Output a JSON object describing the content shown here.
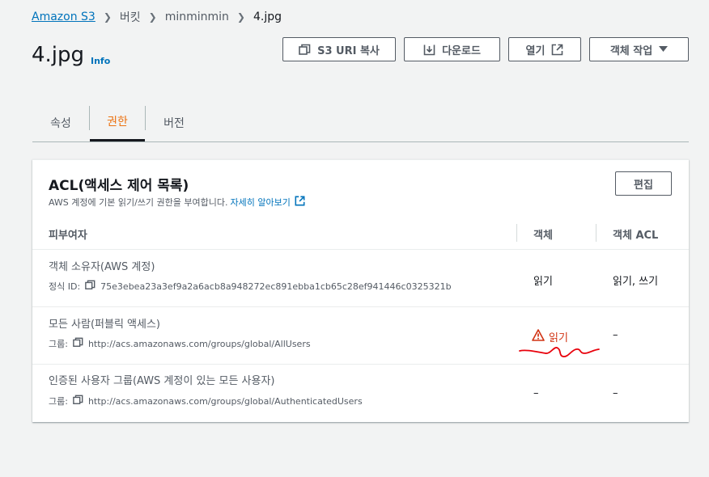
{
  "breadcrumb": {
    "items": [
      "Amazon S3",
      "버킷",
      "minminmin",
      "4.jpg"
    ]
  },
  "header": {
    "title": "4.jpg",
    "info": "Info"
  },
  "toolbar": {
    "copy_uri": "S3 URI 복사",
    "download": "다운로드",
    "open": "열기",
    "object_actions": "객체 작업"
  },
  "tabs": [
    "속성",
    "권한",
    "버전"
  ],
  "active_tab": "권한",
  "acl": {
    "title": "ACL(액세스 제어 목록)",
    "description": "AWS 계정에 기본 읽기/쓰기 권한을 부여합니다.",
    "learn_more": "자세히 알아보기",
    "edit": "편집",
    "columns": [
      "피부여자",
      "객체",
      "객체 ACL"
    ],
    "rows": [
      {
        "grantee": "객체 소유자(AWS 계정)",
        "sub_label": "정식 ID:",
        "sub_value": "75e3ebea23a3ef9a2a6acb8a948272ec891ebba1cb65c28ef941446c0325321b",
        "object": "읽기",
        "object_acl": "읽기, 쓰기"
      },
      {
        "grantee": "모든 사람(퍼블릭 액세스)",
        "sub_label": "그룹:",
        "sub_value": "http://acs.amazonaws.com/groups/global/AllUsers",
        "object": "읽기",
        "object_acl": "–"
      },
      {
        "grantee": "인증된 사용자 그룹(AWS 계정이 있는 모든 사용자)",
        "sub_label": "그룹:",
        "sub_value": "http://acs.amazonaws.com/groups/global/AuthenticatedUsers",
        "object": "–",
        "object_acl": "–"
      }
    ]
  },
  "colors": {
    "link": "#0073bb",
    "active_tab": "#ec7211",
    "warning": "#d13212",
    "annotation": "#e8000b"
  }
}
